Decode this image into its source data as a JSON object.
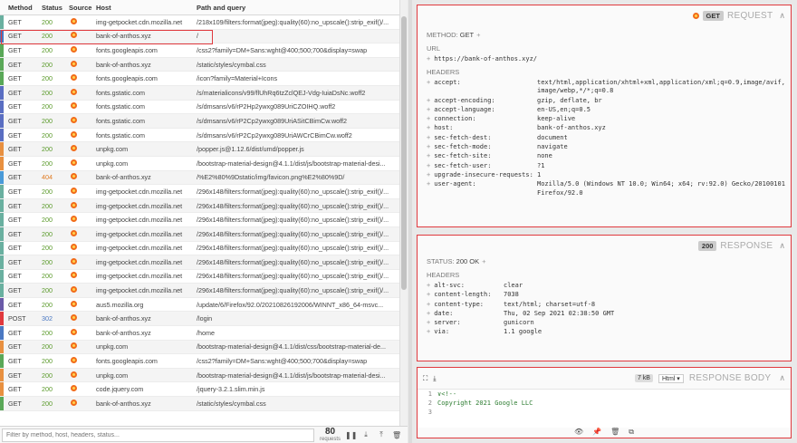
{
  "list": {
    "headers": {
      "method": "Method",
      "status": "Status",
      "source": "Source",
      "host": "Host",
      "path": "Path and query"
    },
    "rows": [
      {
        "method": "GET",
        "status": "200",
        "status_kind": "ok",
        "color": "#6ab0a0",
        "host": "img-getpocket.cdn.mozilla.net",
        "path": "/218x109/filters:format(jpeg):quality(60):no_upscale():strip_exif()/..."
      },
      {
        "method": "GET",
        "status": "200",
        "status_kind": "ok",
        "color": "#4a78c2",
        "host": "bank-of-anthos.xyz",
        "path": "/"
      },
      {
        "method": "GET",
        "status": "200",
        "status_kind": "ok",
        "color": "#5aa858",
        "host": "fonts.googleapis.com",
        "path": "/css2?family=DM+Sans:wght@400;500;700&display=swap"
      },
      {
        "method": "GET",
        "status": "200",
        "status_kind": "ok",
        "color": "#5aa858",
        "host": "bank-of-anthos.xyz",
        "path": "/static/styles/cymbal.css"
      },
      {
        "method": "GET",
        "status": "200",
        "status_kind": "ok",
        "color": "#5aa858",
        "host": "fonts.googleapis.com",
        "path": "/icon?family=Material+Icons"
      },
      {
        "method": "GET",
        "status": "200",
        "status_kind": "ok",
        "color": "#5a6ec2",
        "host": "fonts.gstatic.com",
        "path": "/s/materialicons/v99/flUhRq6tzZclQEJ-Vdg-IuiaDsNc.woff2"
      },
      {
        "method": "GET",
        "status": "200",
        "status_kind": "ok",
        "color": "#5a6ec2",
        "host": "fonts.gstatic.com",
        "path": "/s/dmsans/v6/rP2Hp2ywxg089UriCZOIHQ.woff2"
      },
      {
        "method": "GET",
        "status": "200",
        "status_kind": "ok",
        "color": "#5a6ec2",
        "host": "fonts.gstatic.com",
        "path": "/s/dmsans/v6/rP2Cp2ywxg089UriASitCBimCw.woff2"
      },
      {
        "method": "GET",
        "status": "200",
        "status_kind": "ok",
        "color": "#5a6ec2",
        "host": "fonts.gstatic.com",
        "path": "/s/dmsans/v6/rP2Cp2ywxg089UriAWCrCBimCw.woff2"
      },
      {
        "method": "GET",
        "status": "200",
        "status_kind": "ok",
        "color": "#e89040",
        "host": "unpkg.com",
        "path": "/popper.js@1.12.6/dist/umd/popper.js"
      },
      {
        "method": "GET",
        "status": "200",
        "status_kind": "ok",
        "color": "#e89040",
        "host": "unpkg.com",
        "path": "/bootstrap-material-design@4.1.1/dist/js/bootstrap-material-desi..."
      },
      {
        "method": "GET",
        "status": "404",
        "status_kind": "nf",
        "color": "#4a9ad8",
        "host": "bank-of-anthos.xyz",
        "path": "/%E2%80%9Dstatic/img/favicon.png%E2%80%9D/"
      },
      {
        "method": "GET",
        "status": "200",
        "status_kind": "ok",
        "color": "#6ab0a0",
        "host": "img-getpocket.cdn.mozilla.net",
        "path": "/296x148/filters:format(jpeg):quality(60):no_upscale():strip_exif()/..."
      },
      {
        "method": "GET",
        "status": "200",
        "status_kind": "ok",
        "color": "#6ab0a0",
        "host": "img-getpocket.cdn.mozilla.net",
        "path": "/296x148/filters:format(jpeg):quality(60):no_upscale():strip_exif()/..."
      },
      {
        "method": "GET",
        "status": "200",
        "status_kind": "ok",
        "color": "#6ab0a0",
        "host": "img-getpocket.cdn.mozilla.net",
        "path": "/296x148/filters:format(jpeg):quality(60):no_upscale():strip_exif()/..."
      },
      {
        "method": "GET",
        "status": "200",
        "status_kind": "ok",
        "color": "#6ab0a0",
        "host": "img-getpocket.cdn.mozilla.net",
        "path": "/296x148/filters:format(jpeg):quality(60):no_upscale():strip_exif()/..."
      },
      {
        "method": "GET",
        "status": "200",
        "status_kind": "ok",
        "color": "#6ab0a0",
        "host": "img-getpocket.cdn.mozilla.net",
        "path": "/296x148/filters:format(jpeg):quality(60):no_upscale():strip_exif()/..."
      },
      {
        "method": "GET",
        "status": "200",
        "status_kind": "ok",
        "color": "#6ab0a0",
        "host": "img-getpocket.cdn.mozilla.net",
        "path": "/296x148/filters:format(jpeg):quality(60):no_upscale():strip_exif()/..."
      },
      {
        "method": "GET",
        "status": "200",
        "status_kind": "ok",
        "color": "#6ab0a0",
        "host": "img-getpocket.cdn.mozilla.net",
        "path": "/296x148/filters:format(jpeg):quality(60):no_upscale():strip_exif()/..."
      },
      {
        "method": "GET",
        "status": "200",
        "status_kind": "ok",
        "color": "#6ab0a0",
        "host": "img-getpocket.cdn.mozilla.net",
        "path": "/296x148/filters:format(jpeg):quality(60):no_upscale():strip_exif()/..."
      },
      {
        "method": "GET",
        "status": "200",
        "status_kind": "ok",
        "color": "#6a5aa8",
        "host": "aus5.mozilla.org",
        "path": "/update/6/Firefox/92.0/20210826192006/WINNT_x86_64-msvc..."
      },
      {
        "method": "POST",
        "status": "302",
        "status_kind": "rd",
        "color": "#e0393e",
        "host": "bank-of-anthos.xyz",
        "path": "/login"
      },
      {
        "method": "GET",
        "status": "200",
        "status_kind": "ok",
        "color": "#4a78c2",
        "host": "bank-of-anthos.xyz",
        "path": "/home"
      },
      {
        "method": "GET",
        "status": "200",
        "status_kind": "ok",
        "color": "#e89040",
        "host": "unpkg.com",
        "path": "/bootstrap-material-design@4.1.1/dist/css/bootstrap-material-de..."
      },
      {
        "method": "GET",
        "status": "200",
        "status_kind": "ok",
        "color": "#5aa858",
        "host": "fonts.googleapis.com",
        "path": "/css2?family=DM+Sans:wght@400;500;700&display=swap"
      },
      {
        "method": "GET",
        "status": "200",
        "status_kind": "ok",
        "color": "#e89040",
        "host": "unpkg.com",
        "path": "/bootstrap-material-design@4.1.1/dist/js/bootstrap-material-desi..."
      },
      {
        "method": "GET",
        "status": "200",
        "status_kind": "ok",
        "color": "#e89040",
        "host": "code.jquery.com",
        "path": "/jquery-3.2.1.slim.min.js"
      },
      {
        "method": "GET",
        "status": "200",
        "status_kind": "ok",
        "color": "#5aa858",
        "host": "bank-of-anthos.xyz",
        "path": "/static/styles/cymbal.css"
      }
    ]
  },
  "footer": {
    "filter_placeholder": "Filter by method, host, headers, status...",
    "count": "80",
    "count_label": "requests"
  },
  "request": {
    "method_badge": "GET",
    "title": "REQUEST",
    "method_label": "METHOD:",
    "method_value": "GET",
    "url_label": "URL",
    "url": "https://bank-of-anthos.xyz/",
    "headers_label": "HEADERS",
    "headers": [
      {
        "k": "accept:",
        "v": "text/html,application/xhtml+xml,application/xml;q=0.9,image/avif,image/webp,*/*;q=0.8"
      },
      {
        "k": "accept-encoding:",
        "v": "gzip, deflate, br"
      },
      {
        "k": "accept-language:",
        "v": "en-US,en;q=0.5"
      },
      {
        "k": "connection:",
        "v": "keep-alive"
      },
      {
        "k": "host:",
        "v": "bank-of-anthos.xyz"
      },
      {
        "k": "sec-fetch-dest:",
        "v": "document"
      },
      {
        "k": "sec-fetch-mode:",
        "v": "navigate"
      },
      {
        "k": "sec-fetch-site:",
        "v": "none"
      },
      {
        "k": "sec-fetch-user:",
        "v": "?1"
      },
      {
        "k": "upgrade-insecure-requests:",
        "v": "1"
      },
      {
        "k": "user-agent:",
        "v": "Mozilla/5.0 (Windows NT 10.0; Win64; x64; rv:92.0) Gecko/20100101 Firefox/92.0"
      }
    ]
  },
  "response": {
    "status_badge": "200",
    "title": "RESPONSE",
    "status_label": "STATUS:",
    "status_value": "200 OK",
    "headers_label": "HEADERS",
    "headers": [
      {
        "k": "alt-svc:",
        "v": "clear"
      },
      {
        "k": "content-length:",
        "v": "7038"
      },
      {
        "k": "content-type:",
        "v": "text/html; charset=utf-8"
      },
      {
        "k": "date:",
        "v": "Thu, 02 Sep 2021 02:38:50 GMT"
      },
      {
        "k": "server:",
        "v": "gunicorn"
      },
      {
        "k": "via:",
        "v": "1.1 google"
      }
    ]
  },
  "response_body": {
    "size": "7 kB",
    "format": "Html",
    "title": "RESPONSE BODY",
    "lines": [
      {
        "n": "1",
        "t": "∨<!--"
      },
      {
        "n": "2",
        "t": "   Copyright 2021 Google LLC"
      },
      {
        "n": "3",
        "t": ""
      }
    ]
  }
}
